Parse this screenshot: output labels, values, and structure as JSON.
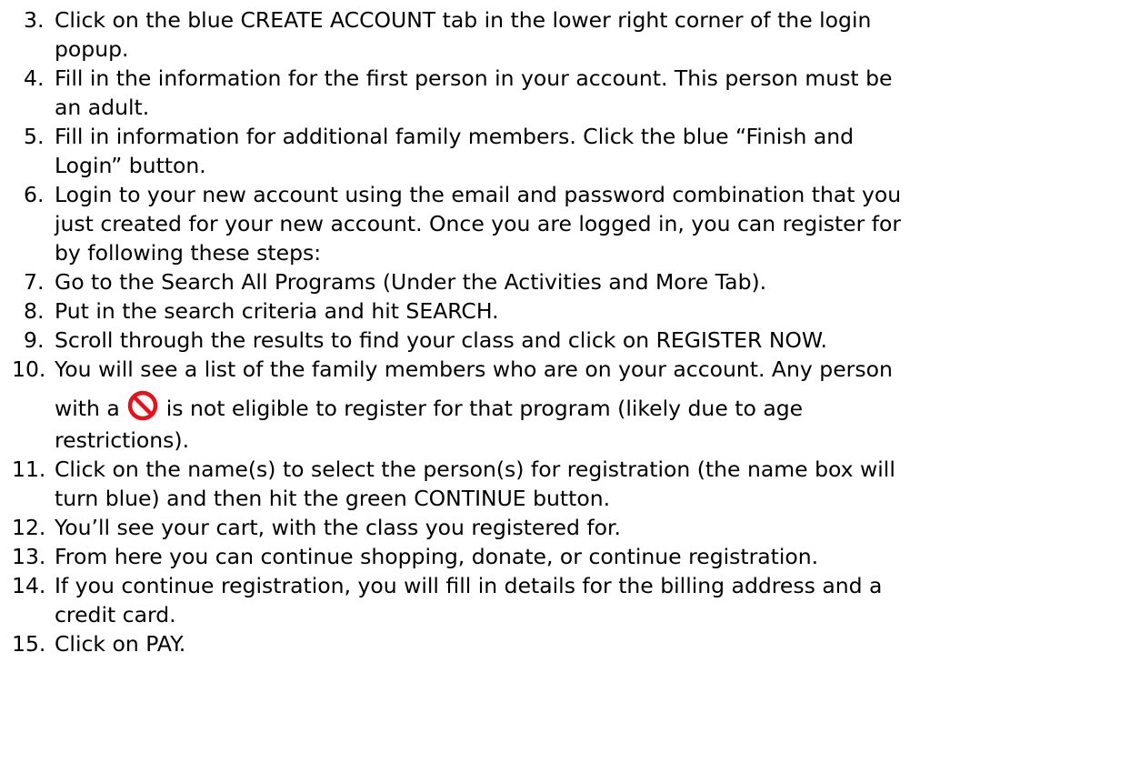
{
  "steps": [
    {
      "number": "3.",
      "lines": [
        "Click on the blue CREATE ACCOUNT tab in the lower right corner of the login",
        "popup."
      ]
    },
    {
      "number": "4.",
      "lines": [
        "Fill in the information for the first person in your account. This person must be",
        "an adult."
      ]
    },
    {
      "number": "5.",
      "lines": [
        "Fill in information for additional family members. Click the blue “Finish and",
        "Login” button."
      ]
    },
    {
      "number": "6.",
      "lines": [
        "Login to your new account using the email and password combination that you",
        "just created for your new account. Once you are logged in, you can register for",
        "by following these steps:"
      ]
    },
    {
      "number": "7.",
      "lines": [
        "Go to the Search All Programs (Under the Activities and More Tab)."
      ]
    },
    {
      "number": "8.",
      "lines": [
        "Put in the search criteria and hit SEARCH."
      ]
    },
    {
      "number": "9.",
      "lines": [
        "Scroll through the results to find your class and click on REGISTER NOW."
      ]
    },
    {
      "number": "10.",
      "line1": "You will see a list of the family members who are on your account. Any person",
      "line2_before": "with a",
      "line2_after": "is not eligible to register for that program (likely due to age",
      "line3": "restrictions).",
      "icon": "prohibited-icon",
      "icon_color": "#e8101a"
    },
    {
      "number": "11.",
      "lines": [
        "Click on the name(s) to select the person(s) for registration (the name box will",
        "turn blue) and then hit the green CONTINUE button."
      ]
    },
    {
      "number": "12.",
      "lines": [
        "You’ll see your cart, with the class you registered for."
      ]
    },
    {
      "number": "13.",
      "lines": [
        "From here you can continue shopping, donate, or continue registration."
      ]
    },
    {
      "number": "14.",
      "lines": [
        "If you continue registration, you will fill in details for the billing address and a",
        "credit card."
      ]
    },
    {
      "number": "15.",
      "lines": [
        "Click on PAY."
      ]
    }
  ]
}
